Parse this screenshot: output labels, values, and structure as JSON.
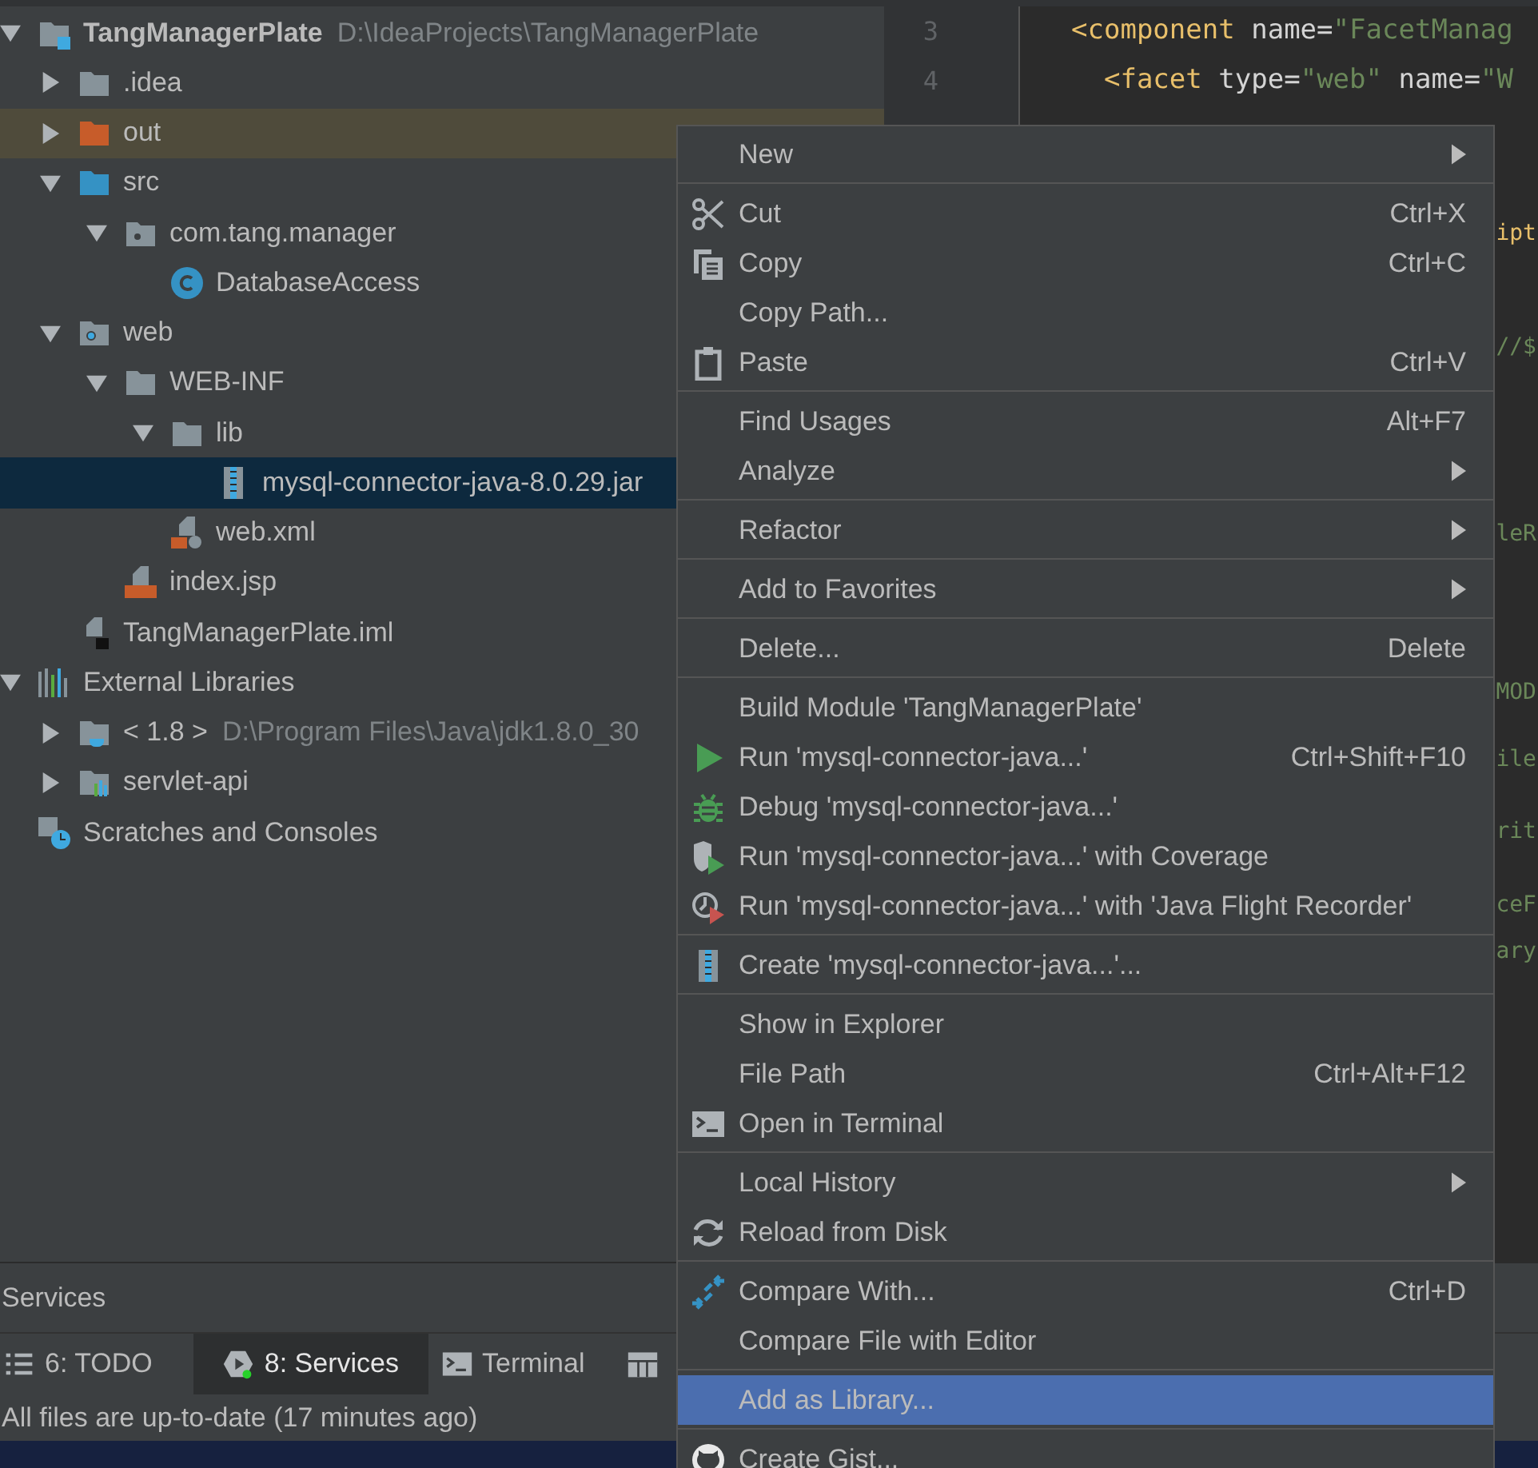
{
  "project_tree": [
    {
      "name": "TangManagerPlate",
      "path": "D:\\IdeaProjects\\TangManagerPlate",
      "kind": "project",
      "expanded": true,
      "selected": false,
      "highlighted": false,
      "children": [
        {
          "name": ".idea",
          "kind": "folder",
          "expanded": false,
          "selected": false,
          "highlighted": false
        },
        {
          "name": "out",
          "kind": "excluded",
          "expanded": false,
          "selected": false,
          "highlighted": true
        },
        {
          "name": "src",
          "kind": "source",
          "expanded": true,
          "selected": false,
          "highlighted": false,
          "children": [
            {
              "name": "com.tang.manager",
              "kind": "package",
              "expanded": true,
              "selected": false,
              "highlighted": false,
              "children": [
                {
                  "name": "DatabaseAccess",
                  "kind": "class",
                  "selected": false,
                  "highlighted": false
                }
              ]
            }
          ]
        },
        {
          "name": "web",
          "kind": "web",
          "expanded": true,
          "selected": false,
          "highlighted": false,
          "children": [
            {
              "name": "WEB-INF",
              "kind": "folder",
              "expanded": true,
              "selected": false,
              "highlighted": false,
              "children": [
                {
                  "name": "lib",
                  "kind": "folder",
                  "expanded": true,
                  "selected": false,
                  "highlighted": false,
                  "children": [
                    {
                      "name": "mysql-connector-java-8.0.29.jar",
                      "kind": "jar",
                      "selected": true,
                      "highlighted": false
                    }
                  ]
                },
                {
                  "name": "web.xml",
                  "kind": "xml",
                  "selected": false,
                  "highlighted": false
                }
              ]
            },
            {
              "name": "index.jsp",
              "kind": "jsp",
              "selected": false,
              "highlighted": false
            }
          ]
        },
        {
          "name": "TangManagerPlate.iml",
          "kind": "iml",
          "selected": false,
          "highlighted": false
        }
      ]
    },
    {
      "name": "External Libraries",
      "kind": "libraries",
      "expanded": true,
      "selected": false,
      "highlighted": false,
      "children": [
        {
          "name": "< 1.8 >",
          "path": "D:\\Program Files\\Java\\jdk1.8.0_30",
          "kind": "jdk",
          "expanded": false,
          "selected": false,
          "highlighted": false
        },
        {
          "name": "servlet-api",
          "kind": "library",
          "expanded": false,
          "selected": false,
          "highlighted": false
        }
      ]
    },
    {
      "name": "Scratches and Consoles",
      "kind": "scratches",
      "selected": false,
      "highlighted": false
    }
  ],
  "editor": {
    "lines": [
      {
        "number": "3",
        "tokens": [
          {
            "kind": "tag",
            "text": "<component"
          },
          {
            "kind": "attr",
            "text": " name"
          },
          {
            "kind": "punct",
            "text": "="
          },
          {
            "kind": "value",
            "text": "\"FacetManag"
          }
        ]
      },
      {
        "number": "4",
        "tokens": [
          {
            "kind": "tag",
            "text": "  <facet"
          },
          {
            "kind": "attr",
            "text": " type"
          },
          {
            "kind": "punct",
            "text": "="
          },
          {
            "kind": "value",
            "text": "\"web\""
          },
          {
            "kind": "attr",
            "text": " name"
          },
          {
            "kind": "punct",
            "text": "="
          },
          {
            "kind": "value",
            "text": "\"W"
          }
        ]
      }
    ],
    "fragments": [
      {
        "kind": "tag",
        "text": "ipt"
      },
      {
        "kind": "value",
        "text": "//$"
      },
      {
        "kind": "value",
        "text": "leR"
      },
      {
        "kind": "value",
        "text": "MOD"
      },
      {
        "kind": "value",
        "text": "ile"
      },
      {
        "kind": "value",
        "text": "rit"
      },
      {
        "kind": "value",
        "text": "ceF"
      },
      {
        "kind": "value",
        "text": "ary"
      }
    ]
  },
  "services_panel": {
    "title": "Services"
  },
  "tool_tabs": [
    {
      "label": "6: TODO",
      "selected": false
    },
    {
      "label": "8: Services",
      "selected": true
    },
    {
      "label": "Terminal",
      "selected": false
    },
    {
      "selected": false
    }
  ],
  "status_bar": {
    "text": "All files are up-to-date (17 minutes ago)"
  },
  "context_menu": [
    {
      "kind": "item",
      "label": "New",
      "submenu": true,
      "selected": false
    },
    {
      "kind": "separator"
    },
    {
      "kind": "item",
      "label": "Cut",
      "shortcut": "Ctrl+X",
      "submenu": false,
      "selected": false
    },
    {
      "kind": "item",
      "label": "Copy",
      "shortcut": "Ctrl+C",
      "submenu": false,
      "selected": false
    },
    {
      "kind": "item",
      "label": "Copy Path...",
      "submenu": false,
      "selected": false
    },
    {
      "kind": "item",
      "label": "Paste",
      "shortcut": "Ctrl+V",
      "submenu": false,
      "selected": false
    },
    {
      "kind": "separator"
    },
    {
      "kind": "item",
      "label": "Find Usages",
      "shortcut": "Alt+F7",
      "submenu": false,
      "selected": false
    },
    {
      "kind": "item",
      "label": "Analyze",
      "submenu": true,
      "selected": false
    },
    {
      "kind": "separator"
    },
    {
      "kind": "item",
      "label": "Refactor",
      "submenu": true,
      "selected": false
    },
    {
      "kind": "separator"
    },
    {
      "kind": "item",
      "label": "Add to Favorites",
      "submenu": true,
      "selected": false
    },
    {
      "kind": "separator"
    },
    {
      "kind": "item",
      "label": "Delete...",
      "shortcut": "Delete",
      "submenu": false,
      "selected": false
    },
    {
      "kind": "separator"
    },
    {
      "kind": "item",
      "label": "Build Module 'TangManagerPlate'",
      "submenu": false,
      "selected": false
    },
    {
      "kind": "item",
      "label": "Run 'mysql-connector-java...'",
      "shortcut": "Ctrl+Shift+F10",
      "submenu": false,
      "selected": false
    },
    {
      "kind": "item",
      "label": "Debug 'mysql-connector-java...'",
      "submenu": false,
      "selected": false
    },
    {
      "kind": "item",
      "label": "Run 'mysql-connector-java...' with Coverage",
      "submenu": false,
      "selected": false
    },
    {
      "kind": "item",
      "label": "Run 'mysql-connector-java...' with 'Java Flight Recorder'",
      "submenu": false,
      "selected": false
    },
    {
      "kind": "separator"
    },
    {
      "kind": "item",
      "label": "Create 'mysql-connector-java...'...",
      "submenu": false,
      "selected": false
    },
    {
      "kind": "separator"
    },
    {
      "kind": "item",
      "label": "Show in Explorer",
      "submenu": false,
      "selected": false
    },
    {
      "kind": "item",
      "label": "File Path",
      "shortcut": "Ctrl+Alt+F12",
      "submenu": false,
      "selected": false
    },
    {
      "kind": "item",
      "label": "Open in Terminal",
      "submenu": false,
      "selected": false
    },
    {
      "kind": "separator"
    },
    {
      "kind": "item",
      "label": "Local History",
      "submenu": true,
      "selected": false
    },
    {
      "kind": "item",
      "label": "Reload from Disk",
      "submenu": false,
      "selected": false
    },
    {
      "kind": "separator"
    },
    {
      "kind": "item",
      "label": "Compare With...",
      "shortcut": "Ctrl+D",
      "submenu": false,
      "selected": false
    },
    {
      "kind": "item",
      "label": "Compare File with Editor",
      "submenu": false,
      "selected": false
    },
    {
      "kind": "separator"
    },
    {
      "kind": "item",
      "label": "Add as Library...",
      "submenu": false,
      "selected": true
    },
    {
      "kind": "separator"
    },
    {
      "kind": "item",
      "label": "Create Gist...",
      "submenu": false,
      "selected": false
    }
  ]
}
